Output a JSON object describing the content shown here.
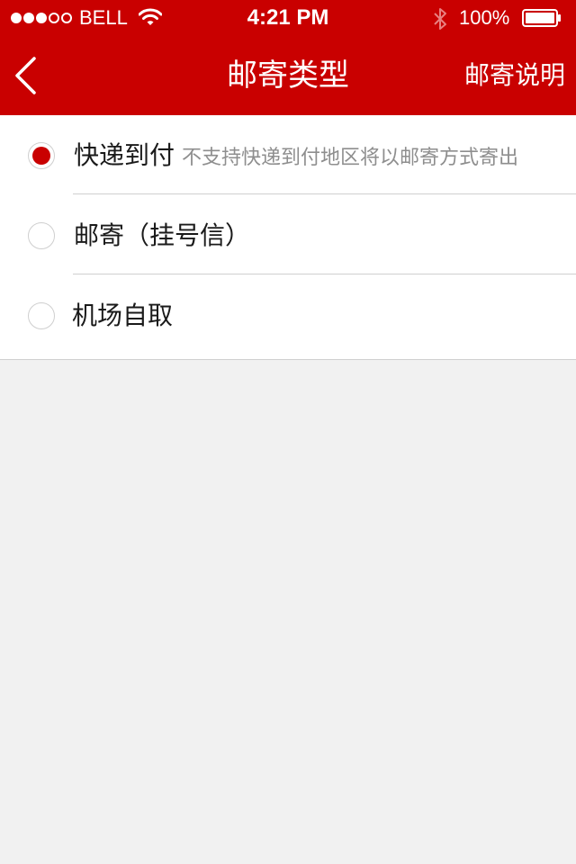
{
  "status_bar": {
    "carrier": "BELL",
    "time": "4:21 PM",
    "battery": "100%",
    "signal_strength": 3,
    "signal_max": 5
  },
  "nav": {
    "title": "邮寄类型",
    "right_action": "邮寄说明",
    "back_icon": "chevron-left-icon"
  },
  "options": [
    {
      "label": "快递到付",
      "note": "不支持快递到付地区将以邮寄方式寄出",
      "selected": true
    },
    {
      "label": "邮寄（挂号信）",
      "selected": false
    },
    {
      "label": "机场自取",
      "selected": false
    }
  ],
  "colors": {
    "brand_red": "#c90000",
    "background": "#f1f1f1",
    "separator": "#cfcfcf",
    "note_text": "#8e8e8e"
  }
}
